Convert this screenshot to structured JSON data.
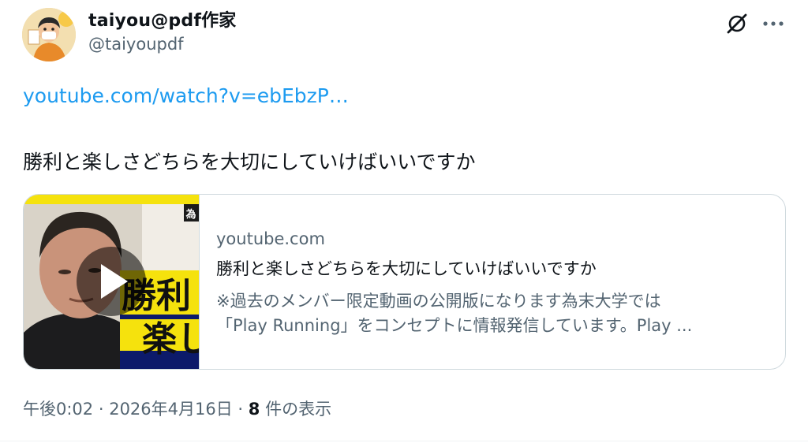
{
  "author": {
    "display_name": "taiyou@pdf作家",
    "handle": "@taiyoupdf"
  },
  "icons": {
    "grok": "grok-slash-circle-icon",
    "more": "more-dots-icon",
    "play": "play-icon"
  },
  "tweet": {
    "link_text": "youtube.com/watch?v=ebEbzP…",
    "text": "勝利と楽しさどちらを大切にしていけばいいですか"
  },
  "card": {
    "domain": "youtube.com",
    "title": "勝利と楽しさどちらを大切にしていけばいいですか",
    "description_line1": "※過去のメンバー限定動画の公開版になります為末大学では",
    "description_line2": "「Play Running」をコンセプトに情報発信しています。Play ...",
    "thumbnail_overlay": {
      "line1": "勝利",
      "line2": "楽し",
      "corner": "為"
    }
  },
  "meta": {
    "time": "午後0:02",
    "separator": " · ",
    "date": "2026年4月16日",
    "views_count": "8",
    "views_label": " 件の表示"
  },
  "colors": {
    "link": "#1d9bf0",
    "secondary_text": "#536471",
    "card_border": "#cfd9de",
    "thumbnail_yellow": "#f5e20d"
  }
}
